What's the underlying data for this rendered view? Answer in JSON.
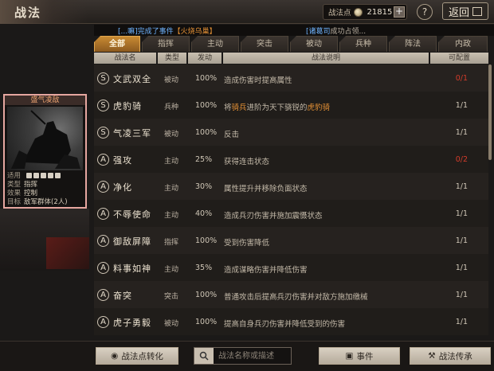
{
  "header": {
    "title": "战法",
    "points_label": "战法点",
    "points_value": "21815",
    "plus": "+",
    "help": "?",
    "back_label": "返回"
  },
  "news": {
    "left_prefix": "[...嘛]完成了事件",
    "left_highlight": "【火烧乌巢】",
    "right_highlight": "[诸葛司",
    "right_suffix": "成功占领..."
  },
  "tabs": [
    {
      "label": "全部",
      "active": true
    },
    {
      "label": "指挥",
      "active": false
    },
    {
      "label": "主动",
      "active": false
    },
    {
      "label": "突击",
      "active": false
    },
    {
      "label": "被动",
      "active": false
    },
    {
      "label": "兵种",
      "active": false
    },
    {
      "label": "阵法",
      "active": false
    },
    {
      "label": "内政",
      "active": false
    }
  ],
  "columns": {
    "name": "战法名",
    "type": "类型",
    "rate": "发动",
    "desc": "战法说明",
    "config": "可配置"
  },
  "rows": [
    {
      "grade": "S",
      "name": "文武双全",
      "type": "被动",
      "rate": "100%",
      "desc": "造成伤害时提高属性",
      "config": "0/1",
      "config_red": true
    },
    {
      "grade": "S",
      "name": "虎豹骑",
      "type": "兵种",
      "rate": "100%",
      "desc_pre": "将",
      "desc_hl1": "骑兵",
      "desc_mid": "进阶为天下骁锐的",
      "desc_hl2": "虎豹骑",
      "config": "1/1",
      "config_red": false
    },
    {
      "grade": "S",
      "name": "气凌三军",
      "type": "被动",
      "rate": "100%",
      "desc": "反击",
      "config": "1/1",
      "config_red": false
    },
    {
      "grade": "A",
      "name": "强攻",
      "type": "主动",
      "rate": "25%",
      "desc": "获得连击状态",
      "config": "0/2",
      "config_red": true
    },
    {
      "grade": "A",
      "name": "净化",
      "type": "主动",
      "rate": "30%",
      "desc": "属性提升并移除负面状态",
      "config": "1/1",
      "config_red": false
    },
    {
      "grade": "A",
      "name": "不辱使命",
      "type": "主动",
      "rate": "40%",
      "desc": "造成兵刃伤害并施加震慑状态",
      "config": "1/1",
      "config_red": false
    },
    {
      "grade": "A",
      "name": "御敌屏障",
      "type": "指挥",
      "rate": "100%",
      "desc": "受到伤害降低",
      "config": "1/1",
      "config_red": false
    },
    {
      "grade": "A",
      "name": "料事如神",
      "type": "主动",
      "rate": "35%",
      "desc": "造成谋略伤害并降低伤害",
      "config": "1/1",
      "config_red": false
    },
    {
      "grade": "A",
      "name": "奋突",
      "type": "突击",
      "rate": "100%",
      "desc": "普通攻击后提高兵刃伤害并对敌方施加缴械",
      "config": "1/1",
      "config_red": false
    },
    {
      "grade": "A",
      "name": "虎子勇毅",
      "type": "被动",
      "rate": "100%",
      "desc": "提高自身兵刃伤害并降低受到的伤害",
      "config": "1/1",
      "config_red": false
    }
  ],
  "card": {
    "title": "盛气凌敌",
    "label_use": "适用",
    "label_type": "类型",
    "type_value": "指挥",
    "label_effect": "效果",
    "effect_value": "控制",
    "label_target": "目标",
    "target_value": "敌军群体(2人)"
  },
  "bottom": {
    "convert_label": "战法点转化",
    "search_placeholder": "战法名称或描述",
    "event_label": "事件",
    "inherit_label": "战法传承"
  }
}
